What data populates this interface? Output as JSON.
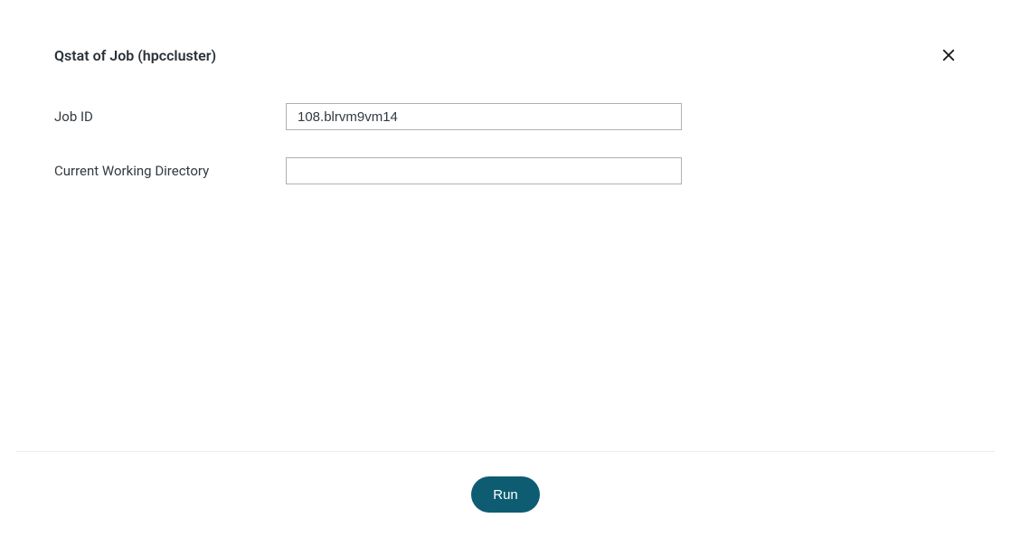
{
  "dialog": {
    "title": "Qstat of Job (hpccluster)"
  },
  "form": {
    "job_id": {
      "label": "Job ID",
      "value": "108.blrvm9vm14"
    },
    "cwd": {
      "label": "Current Working Directory",
      "value": ""
    }
  },
  "footer": {
    "run_label": "Run"
  }
}
